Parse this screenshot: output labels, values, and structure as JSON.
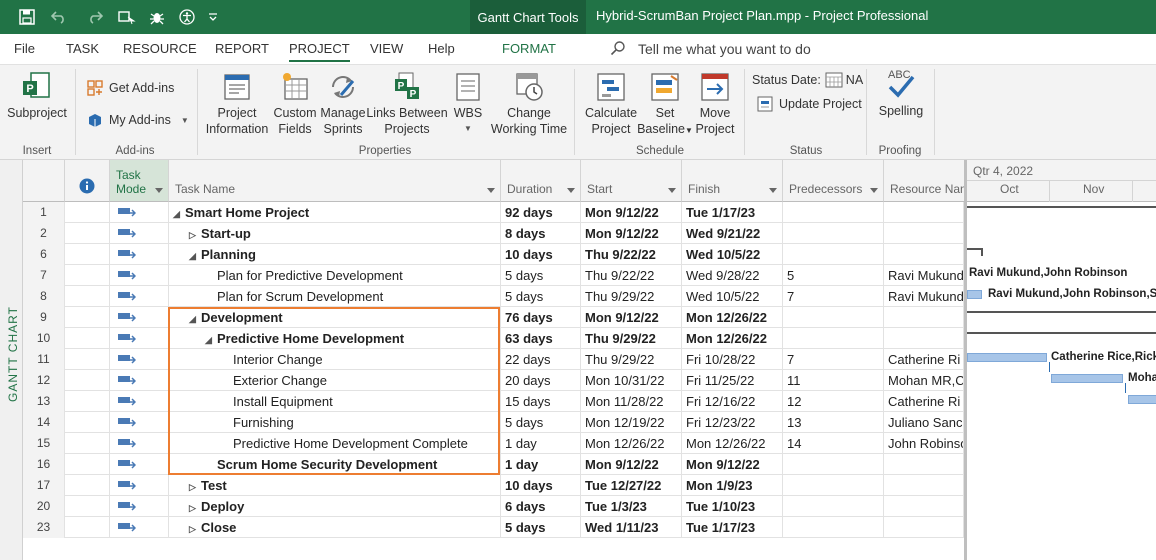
{
  "title_bar": {
    "context_tab": "Gantt Chart Tools",
    "document_title": "Hybrid-ScrumBan Project Plan.mpp  -  Project Professional"
  },
  "tabs": [
    "File",
    "TASK",
    "RESOURCE",
    "REPORT",
    "PROJECT",
    "VIEW",
    "Help",
    "FORMAT"
  ],
  "active_tab": "PROJECT",
  "tell_me": "Tell me what you want to do",
  "ribbon": {
    "insert": {
      "subproject": "Subproject",
      "group": "Insert"
    },
    "addins": {
      "get": "Get Add-ins",
      "my": "My Add-ins",
      "group": "Add-ins"
    },
    "properties": {
      "project_information": [
        "Project",
        "Information"
      ],
      "custom_fields": [
        "Custom",
        "Fields"
      ],
      "manage_sprints": [
        "Manage",
        "Sprints"
      ],
      "links_between": [
        "Links Between",
        "Projects"
      ],
      "wbs": "WBS",
      "change_working_time": [
        "Change",
        "Working Time"
      ],
      "group": "Properties"
    },
    "schedule": {
      "calculate": [
        "Calculate",
        "Project"
      ],
      "set_baseline": [
        "Set",
        "Baseline"
      ],
      "move": [
        "Move",
        "Project"
      ],
      "group": "Schedule"
    },
    "status": {
      "status_date": "Status Date:",
      "status_date_value": "NA",
      "update": "Update Project",
      "group": "Status"
    },
    "proofing": {
      "spelling": "Spelling",
      "abc": "ABC",
      "group": "Proofing"
    }
  },
  "view_label": "GANTT CHART",
  "columns": {
    "info": "i",
    "task_mode": [
      "Task",
      "Mode"
    ],
    "task_name": "Task Name",
    "duration": "Duration",
    "start": "Start",
    "finish": "Finish",
    "predecessors": "Predecessors",
    "resource": "Resource Nam"
  },
  "rows": [
    {
      "id": "1",
      "name": "Smart Home Project",
      "duration": "92 days",
      "start": "Mon 9/12/22",
      "finish": "Tue 1/17/23",
      "pred": "",
      "res": ""
    },
    {
      "id": "2",
      "name": "Start-up",
      "duration": "8 days",
      "start": "Mon 9/12/22",
      "finish": "Wed 9/21/22",
      "pred": "",
      "res": ""
    },
    {
      "id": "6",
      "name": "Planning",
      "duration": "10 days",
      "start": "Thu 9/22/22",
      "finish": "Wed 10/5/22",
      "pred": "",
      "res": ""
    },
    {
      "id": "7",
      "name": "Plan for Predictive Development",
      "duration": "5 days",
      "start": "Thu 9/22/22",
      "finish": "Wed 9/28/22",
      "pred": "5",
      "res": "Ravi Mukund"
    },
    {
      "id": "8",
      "name": "Plan for Scrum Development",
      "duration": "5 days",
      "start": "Thu 9/29/22",
      "finish": "Wed 10/5/22",
      "pred": "7",
      "res": "Ravi Mukund"
    },
    {
      "id": "9",
      "name": "Development",
      "duration": "76 days",
      "start": "Mon 9/12/22",
      "finish": "Mon 12/26/22",
      "pred": "",
      "res": ""
    },
    {
      "id": "10",
      "name": "Predictive Home Development",
      "duration": "63 days",
      "start": "Thu 9/29/22",
      "finish": "Mon 12/26/22",
      "pred": "",
      "res": ""
    },
    {
      "id": "11",
      "name": "Interior Change",
      "duration": "22 days",
      "start": "Thu 9/29/22",
      "finish": "Fri 10/28/22",
      "pred": "7",
      "res": "Catherine Ri"
    },
    {
      "id": "12",
      "name": "Exterior Change",
      "duration": "20 days",
      "start": "Mon 10/31/22",
      "finish": "Fri 11/25/22",
      "pred": "11",
      "res": "Mohan MR,C"
    },
    {
      "id": "13",
      "name": "Install Equipment",
      "duration": "15 days",
      "start": "Mon 11/28/22",
      "finish": "Fri 12/16/22",
      "pred": "12",
      "res": "Catherine Ri"
    },
    {
      "id": "14",
      "name": "Furnishing",
      "duration": "5 days",
      "start": "Mon 12/19/22",
      "finish": "Fri 12/23/22",
      "pred": "13",
      "res": "Juliano Sanc"
    },
    {
      "id": "15",
      "name": "Predictive Home Development Complete",
      "duration": "1 day",
      "start": "Mon 12/26/22",
      "finish": "Mon 12/26/22",
      "pred": "14",
      "res": "John Robinso"
    },
    {
      "id": "16",
      "name": "Scrum Home Security Development",
      "duration": "1 day",
      "start": "Mon 9/12/22",
      "finish": "Mon 9/12/22",
      "pred": "",
      "res": ""
    },
    {
      "id": "17",
      "name": "Test",
      "duration": "10 days",
      "start": "Tue 12/27/22",
      "finish": "Mon 1/9/23",
      "pred": "",
      "res": ""
    },
    {
      "id": "20",
      "name": "Deploy",
      "duration": "6 days",
      "start": "Tue 1/3/23",
      "finish": "Tue 1/10/23",
      "pred": "",
      "res": ""
    },
    {
      "id": "23",
      "name": "Close",
      "duration": "5 days",
      "start": "Wed 1/11/23",
      "finish": "Tue 1/17/23",
      "pred": "",
      "res": ""
    }
  ],
  "gantt": {
    "quarter": "Qtr 4, 2022",
    "months": [
      "Oct",
      "Nov"
    ],
    "labels": {
      "plan_predictive": "Ravi Mukund,John Robinson",
      "plan_scrum": "Ravi Mukund,John Robinson,Scr",
      "interior": "Catherine Rice,Rick",
      "exterior": "Moha"
    }
  },
  "colors": {
    "brand_green": "#217346",
    "selection_outline": "#ed7d31",
    "gantt_bar": "#a7c5e8"
  }
}
